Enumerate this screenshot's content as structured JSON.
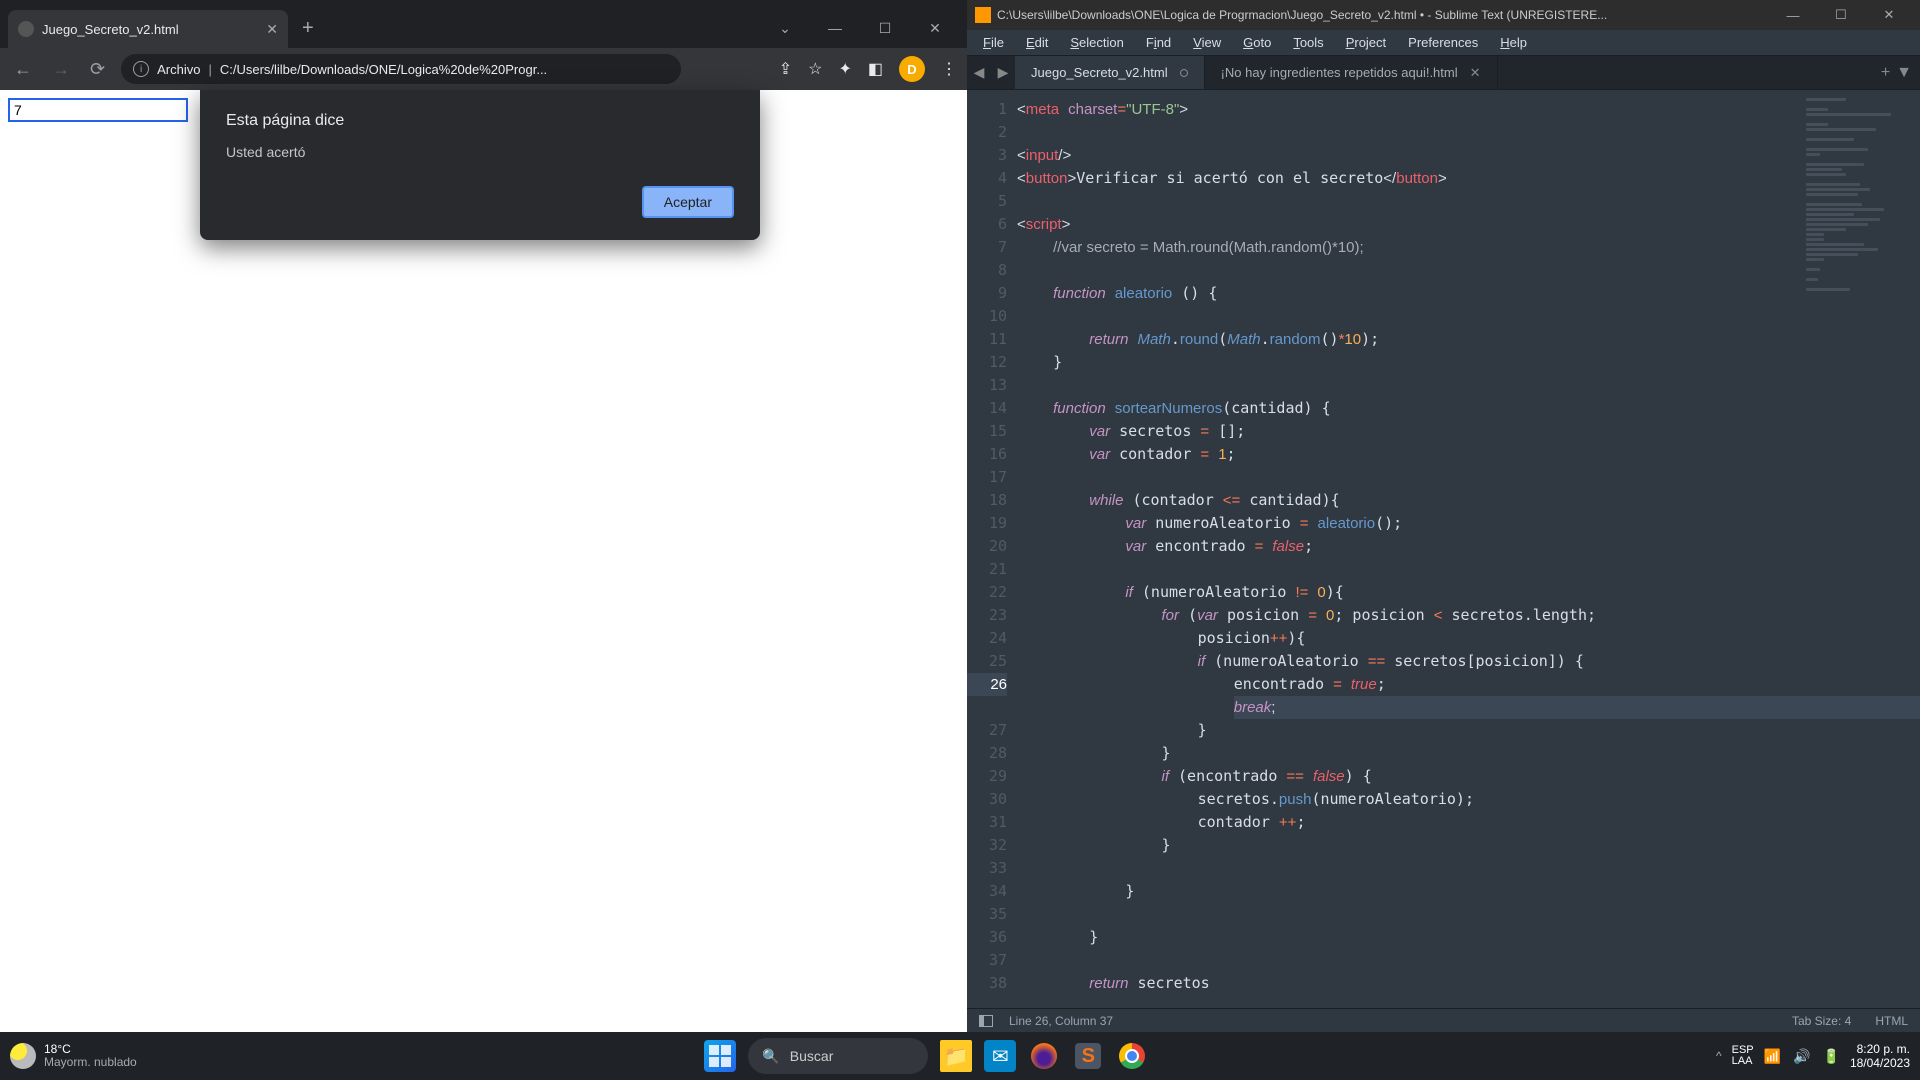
{
  "chrome": {
    "tab_title": "Juego_Secreto_v2.html",
    "omnibox_label": "Archivo",
    "omnibox_path": "C:/Users/lilbe/Downloads/ONE/Logica%20de%20Progr...",
    "avatar_letter": "D",
    "page_input_value": "7",
    "dialog": {
      "title": "Esta página dice",
      "message": "Usted acertó",
      "ok": "Aceptar"
    }
  },
  "sublime": {
    "title": "C:\\Users\\lilbe\\Downloads\\ONE\\Logica de Progrmacion\\Juego_Secreto_v2.html • - Sublime Text (UNREGISTERE...",
    "menu": [
      "File",
      "Edit",
      "Selection",
      "Find",
      "View",
      "Goto",
      "Tools",
      "Project",
      "Preferences",
      "Help"
    ],
    "tabs": [
      {
        "name": "Juego_Secreto_v2.html",
        "modified": true,
        "active": true
      },
      {
        "name": "¡No hay ingredientes repetidos aqui!.html",
        "modified": false,
        "active": false
      }
    ],
    "status_left": "Line 26, Column 37",
    "status_tabsize": "Tab Size: 4",
    "status_syntax": "HTML",
    "line_start": 1,
    "line_end": 38,
    "current_line": 26
  },
  "taskbar": {
    "temp": "18°C",
    "weather": "Mayorm. nublado",
    "search_placeholder": "Buscar",
    "lang1": "ESP",
    "lang2": "LAA",
    "time": "8:20 p. m.",
    "date": "18/04/2023"
  }
}
